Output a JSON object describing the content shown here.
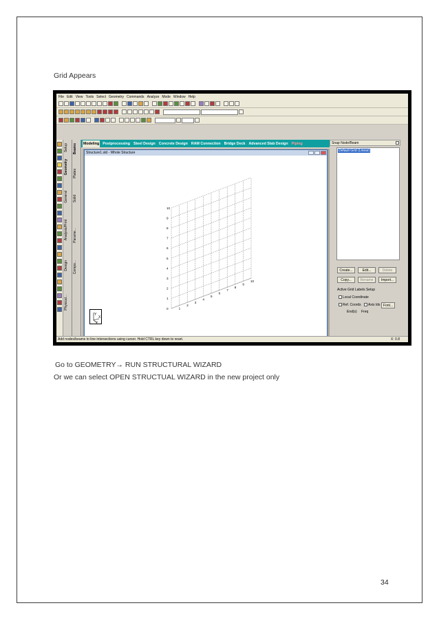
{
  "document": {
    "heading": "Grid Appears",
    "instruction_1": "Go to GEOMETRY→ RUN STRUCTURAL WIZARD",
    "instruction_2": "Or we can select OPEN STRUCTUAL WIZARD in the new project only",
    "page_number": "34"
  },
  "screenshot": {
    "menu": [
      "File",
      "Edit",
      "View",
      "Tools",
      "Select",
      "Geometry",
      "Commands",
      "Analyze",
      "Mode",
      "Window",
      "Help"
    ],
    "tabs": [
      "Modeling",
      "Postprocessing",
      "Steel Design",
      "Concrete Design",
      "RAM Connection",
      "Bridge Deck",
      "Advanced Slab Design",
      "Piping"
    ],
    "active_tab": "Modeling",
    "vertical_tabs_col1": [
      "Setup",
      "Geometry",
      "General",
      "Analysis/Print",
      "Design",
      "Physical..."
    ],
    "vertical_tabs_col2": [
      "Beams",
      "Plates",
      "Solid",
      "Parame...",
      "Compo..."
    ],
    "window_title": "Structure1.std - Whole Structure",
    "grid_labels_vertical": [
      "10",
      "9",
      "8",
      "7",
      "6",
      "5",
      "4",
      "3",
      "2",
      "1",
      "0"
    ],
    "grid_labels_horizontal": [
      "1",
      "2",
      "3",
      "4",
      "5",
      "6",
      "7",
      "8",
      "9",
      "10"
    ],
    "axis_labels": [
      "Y",
      "X",
      "Z"
    ],
    "right_panel": {
      "title": "Snap Node/Beam",
      "list_item": "Default Grid (Linear)",
      "buttons": [
        "Create...",
        "Edit...",
        "Delete",
        "Copy...",
        "Rename",
        "Import..."
      ],
      "section_title": "Active Grid Labels Setup",
      "local_coordinate": "Local Coordinate",
      "ref_coords": "Ref. Coords",
      "axis_ids": "Axis Ids",
      "font": "Font...",
      "end_label": "End(s)",
      "freq_label": "Freq"
    },
    "status_text": "Add nodes/beams to line intersections using cursor. Hold CTRL key down to reset.",
    "status_coord": "X: 0.8"
  }
}
